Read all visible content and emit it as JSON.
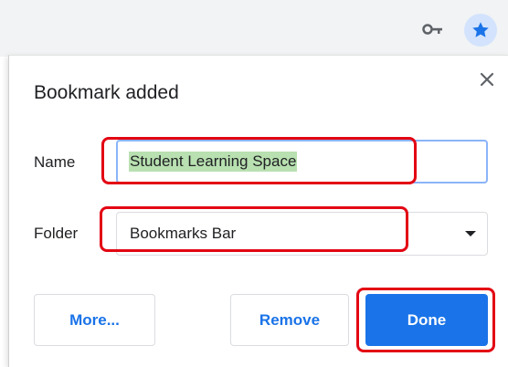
{
  "toolbar": {
    "icons": [
      "key-icon",
      "star-icon"
    ],
    "accent": "#1a73e8"
  },
  "dialog": {
    "title": "Bookmark added",
    "close_icon": "close-icon",
    "name_label": "Name",
    "name_value": "Student Learning Space",
    "folder_label": "Folder",
    "folder_value": "Bookmarks Bar",
    "folder_icon": "chevron-down-icon",
    "buttons": {
      "more": "More...",
      "remove": "Remove",
      "done": "Done"
    }
  },
  "colors": {
    "highlight": "#e30613",
    "primary": "#1a73e8",
    "selection": "#b8e0b0"
  }
}
